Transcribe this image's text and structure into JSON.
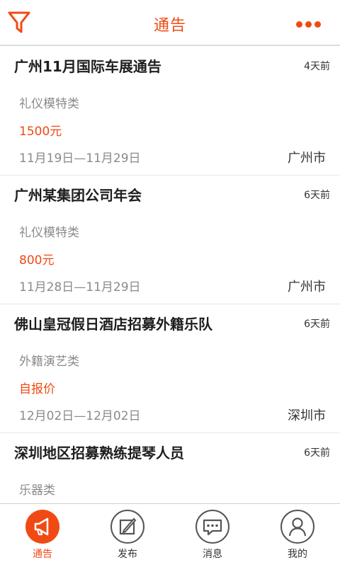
{
  "header": {
    "title": "通告",
    "filter_icon": "filter-icon",
    "more_icon": "more-dots-icon"
  },
  "colors": {
    "accent": "#f04a14",
    "price": "#ef4a12",
    "muted": "#8a8a8a"
  },
  "notices": [
    {
      "title": "广州11月国际车展通告",
      "ago": "4天前",
      "category": "礼仪模特类",
      "price": "1500元",
      "dates": "11月19日—11月29日",
      "city": "广州市"
    },
    {
      "title": "广州某集团公司年会",
      "ago": "6天前",
      "category": "礼仪模特类",
      "price": "800元",
      "dates": "11月28日—11月29日",
      "city": "广州市"
    },
    {
      "title": "佛山皇冠假日酒店招募外籍乐队",
      "ago": "6天前",
      "category": "外籍演艺类",
      "price": "自报价",
      "dates": "12月02日—12月02日",
      "city": "深圳市"
    },
    {
      "title": "深圳地区招募熟练提琴人员",
      "ago": "6天前",
      "category": "乐器类"
    }
  ],
  "tabs": [
    {
      "label": "通告",
      "icon": "megaphone-icon",
      "active": true
    },
    {
      "label": "发布",
      "icon": "edit-icon",
      "active": false
    },
    {
      "label": "消息",
      "icon": "message-icon",
      "active": false
    },
    {
      "label": "我的",
      "icon": "user-icon",
      "active": false
    }
  ]
}
